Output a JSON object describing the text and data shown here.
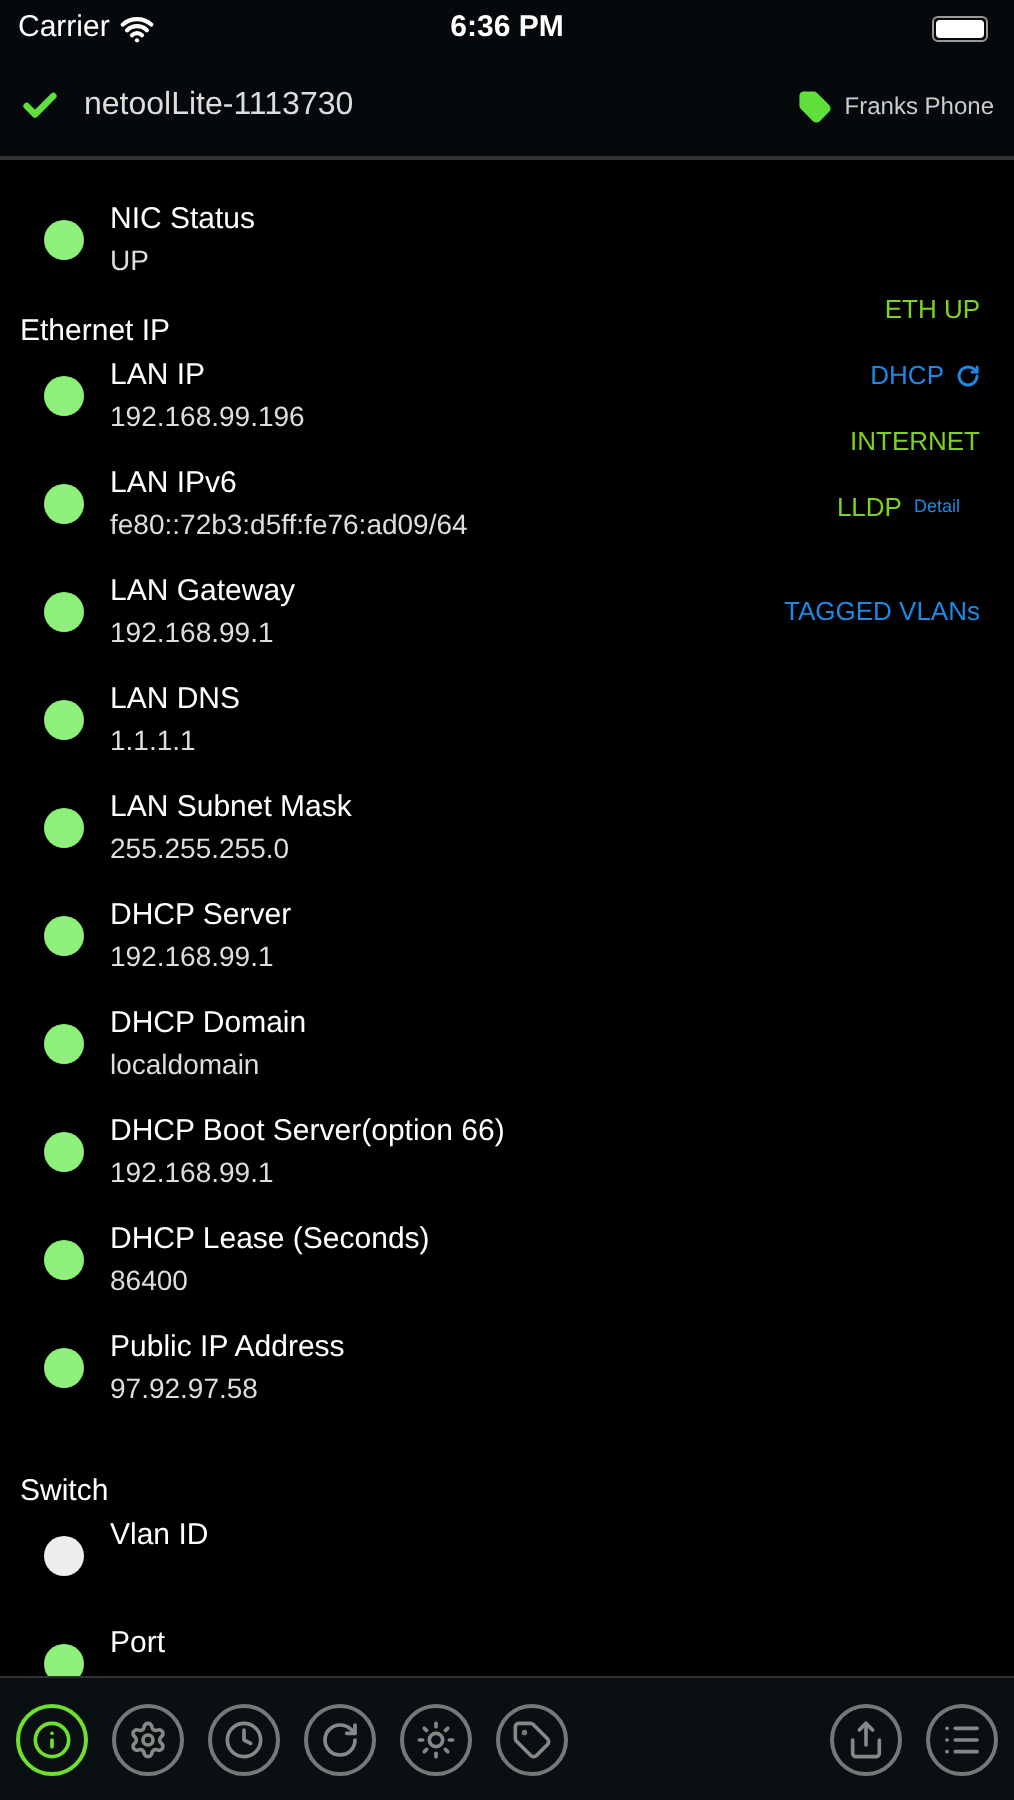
{
  "status_bar": {
    "carrier": "Carrier",
    "time": "6:36 PM"
  },
  "header": {
    "title": "netoolLite-1113730",
    "device": "Franks Phone"
  },
  "sections": [
    {
      "items": [
        {
          "label": "NIC Status",
          "value": "UP",
          "color": "#8ef07a"
        }
      ]
    },
    {
      "title": "Ethernet IP",
      "items": [
        {
          "label": "LAN IP",
          "value": "192.168.99.196",
          "color": "#8ef07a"
        },
        {
          "label": "LAN IPv6",
          "value": "fe80::72b3:d5ff:fe76:ad09/64",
          "color": "#8ef07a"
        },
        {
          "label": "LAN Gateway",
          "value": "192.168.99.1",
          "color": "#8ef07a"
        },
        {
          "label": "LAN DNS",
          "value": "1.1.1.1",
          "color": "#8ef07a"
        },
        {
          "label": "LAN Subnet Mask",
          "value": "255.255.255.0",
          "color": "#8ef07a"
        },
        {
          "label": "DHCP Server",
          "value": "192.168.99.1",
          "color": "#8ef07a"
        },
        {
          "label": "DHCP Domain",
          "value": "localdomain",
          "color": "#8ef07a"
        },
        {
          "label": "DHCP Boot Server(option 66)",
          "value": "192.168.99.1",
          "color": "#8ef07a"
        },
        {
          "label": "DHCP Lease (Seconds)",
          "value": "86400",
          "color": "#8ef07a"
        },
        {
          "label": "Public IP Address",
          "value": "97.92.97.58",
          "color": "#8ef07a"
        }
      ]
    },
    {
      "title": "Switch",
      "items": [
        {
          "label": "Vlan ID",
          "color": "#eeeeee"
        },
        {
          "label": "Port",
          "color": "#8ef07a"
        }
      ]
    }
  ],
  "indicators": [
    {
      "label": "ETH UP",
      "color": "#7ed321"
    },
    {
      "label": "DHCP",
      "color": "#1e88e5",
      "kind": "refresh"
    },
    {
      "label": "INTERNET",
      "color": "#7ed321"
    },
    {
      "label": "LLDP",
      "color": "#7ed321",
      "kind": "detail",
      "detail": "Detail"
    },
    {
      "label": "TAGGED VLANs",
      "color": "#1e88e5",
      "kind": "spaced"
    }
  ],
  "toolbar": [
    {
      "kind": "info",
      "selected": true
    },
    {
      "kind": "settings",
      "selected": false
    },
    {
      "kind": "clock",
      "selected": false
    },
    {
      "kind": "refresh",
      "selected": false
    },
    {
      "kind": "light",
      "selected": false
    },
    {
      "kind": "tag",
      "selected": false
    },
    {
      "kind": "spacer"
    },
    {
      "kind": "share",
      "selected": false
    },
    {
      "kind": "list",
      "selected": false
    }
  ]
}
